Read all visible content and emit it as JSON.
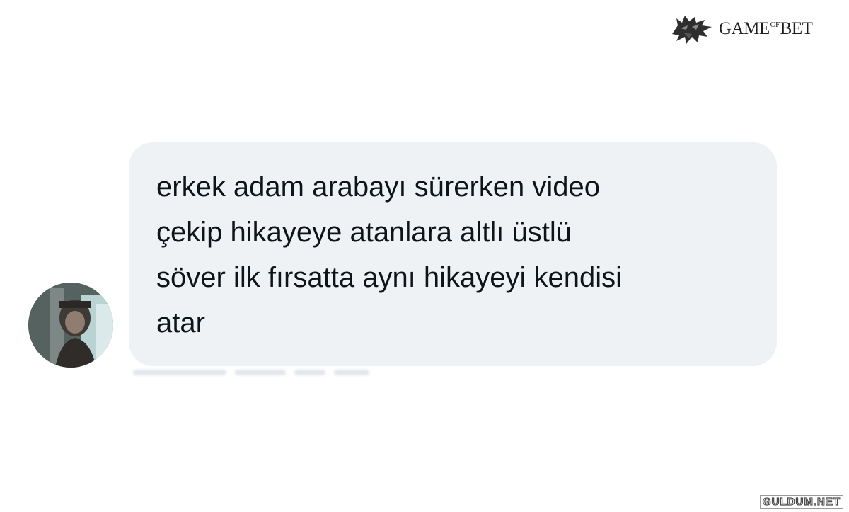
{
  "brand": {
    "prefix": "GAME",
    "of": "OF",
    "suffix": "BET",
    "logo_icon": "wolf-head-icon"
  },
  "conversation": {
    "avatar_icon": "user-avatar-photo",
    "message_text": "erkek adam arabayı sürerken video\nçekip hikayeye atanlara altlı üstlü\nsöver ilk fırsatta aynı hikayeyi kendisi\natar",
    "bubble_color": "#eff2f5",
    "text_color": "#0f1419"
  },
  "watermark": {
    "text": "GULDUM.NET"
  }
}
